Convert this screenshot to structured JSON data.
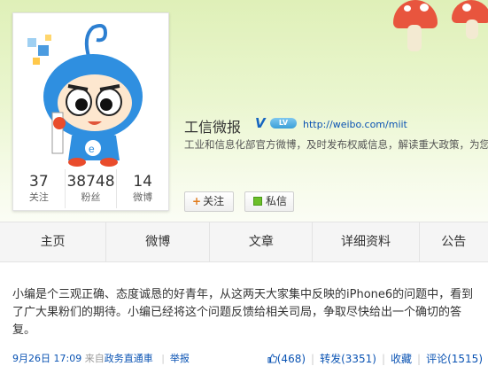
{
  "profile": {
    "name": "工信微报",
    "verified_mark": "V",
    "level_badge": "LV",
    "url": "http://weibo.com/miit",
    "description": "工业和信息化部官方微博，及时发布权威信息，解读重大政策，为您排",
    "stats": [
      {
        "value": "37",
        "label": "关注"
      },
      {
        "value": "38748",
        "label": "粉丝"
      },
      {
        "value": "14",
        "label": "微博"
      }
    ],
    "follow_label": "关注",
    "message_label": "私信"
  },
  "tabs": [
    "主页",
    "微博",
    "文章",
    "详细资料",
    "公告"
  ],
  "post": {
    "text": "小编是个三观正确、态度诚恳的好青年，从这两天大家集中反映的iPhone6的问题中，看到了广大果粉们的期待。小编已经将这个问题反馈给相关司局，争取尽快给出一个确切的答复。",
    "date": "9月26日 17:09",
    "source_prefix": "来自",
    "source": "政务直通車",
    "report": "举报",
    "likes": "(468)",
    "repost": "转发(3351)",
    "favorite": "收藏",
    "comments": "评论(1515)"
  },
  "colors": {
    "accent": "#0a53b3",
    "banner": "#e7f4c9",
    "follow_plus": "#e07a1b"
  }
}
